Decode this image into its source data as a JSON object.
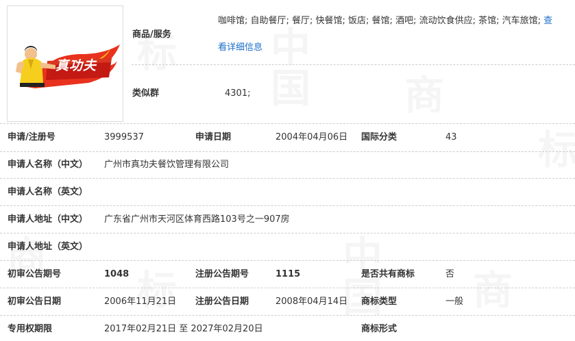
{
  "watermark": {
    "glyphs": [
      "中",
      "国",
      "商",
      "标"
    ]
  },
  "logo": {
    "brand_text": "真功夫"
  },
  "goods": {
    "label": "商品/服务",
    "value": "咖啡馆; 自助餐厅; 餐厅; 快餐馆; 饭店; 餐馆; 酒吧; 流动饮食供应; 茶馆; 汽车旅馆;",
    "more_tail": "查",
    "more_link": "看详细信息"
  },
  "similar_group": {
    "label": "类似群",
    "value": "4301;"
  },
  "rows": {
    "reg_no_label": "申请/注册号",
    "reg_no": "3999537",
    "app_date_label": "申请日期",
    "app_date": "2004年04月06日",
    "intl_class_label": "国际分类",
    "intl_class": "43",
    "applicant_cn_label": "申请人名称（中文）",
    "applicant_cn": "广州市真功夫餐饮管理有限公司",
    "applicant_en_label": "申请人名称（英文）",
    "applicant_en": "",
    "address_cn_label": "申请人地址（中文）",
    "address_cn": "广东省广州市天河区体育西路103号之一907房",
    "address_en_label": "申请人地址（英文）",
    "address_en": "",
    "prelim_issue_label": "初审公告期号",
    "prelim_issue": "1048",
    "reg_issue_label": "注册公告期号",
    "reg_issue": "1115",
    "shared_label": "是否共有商标",
    "shared": "否",
    "prelim_date_label": "初审公告日期",
    "prelim_date": "2006年11月21日",
    "reg_date_label": "注册公告日期",
    "reg_date": "2008年04月14日",
    "type_label": "商标类型",
    "type": "一般",
    "term_label": "专用权期限",
    "term": "2017年02月21日 至 2027年02月20日",
    "form_label": "商标形式",
    "form": ""
  }
}
